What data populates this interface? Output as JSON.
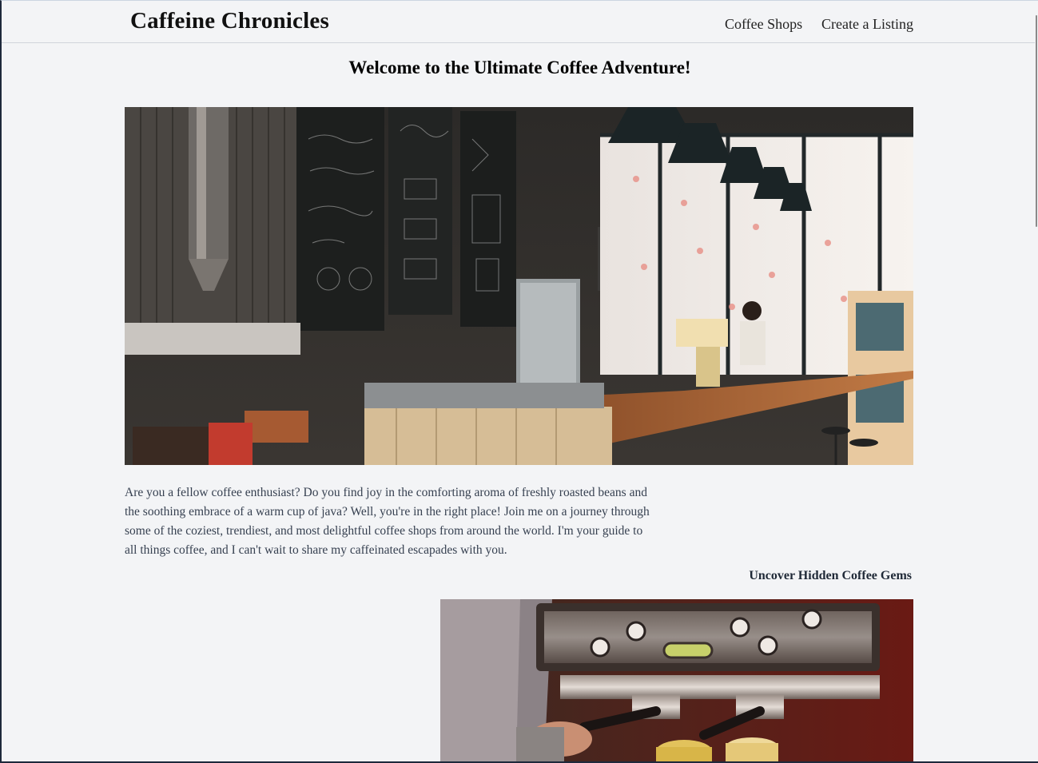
{
  "nav": {
    "brand": "Caffeine Chronicles",
    "links": [
      {
        "label": "Coffee Shops"
      },
      {
        "label": "Create a Listing"
      }
    ]
  },
  "hero": {
    "title": "Welcome to the Ultimate Coffee Adventure!",
    "image_icon": "coffee-shop-interior-photo"
  },
  "intro": {
    "text": "Are you a fellow coffee enthusiast? Do you find joy in the comforting aroma of freshly roasted beans and the soothing embrace of a warm cup of java? Well, you're in the right place! Join me on a journey through some of the coziest, trendiest, and most delightful coffee shops from around the world. I'm your guide to all things coffee, and I can't wait to share my caffeinated escapades with you."
  },
  "section": {
    "heading": "Uncover Hidden Coffee Gems",
    "image_icon": "espresso-machine-photo"
  },
  "colors": {
    "background": "#f3f4f6",
    "text": "#1f2937",
    "wood": "#a0522d"
  }
}
